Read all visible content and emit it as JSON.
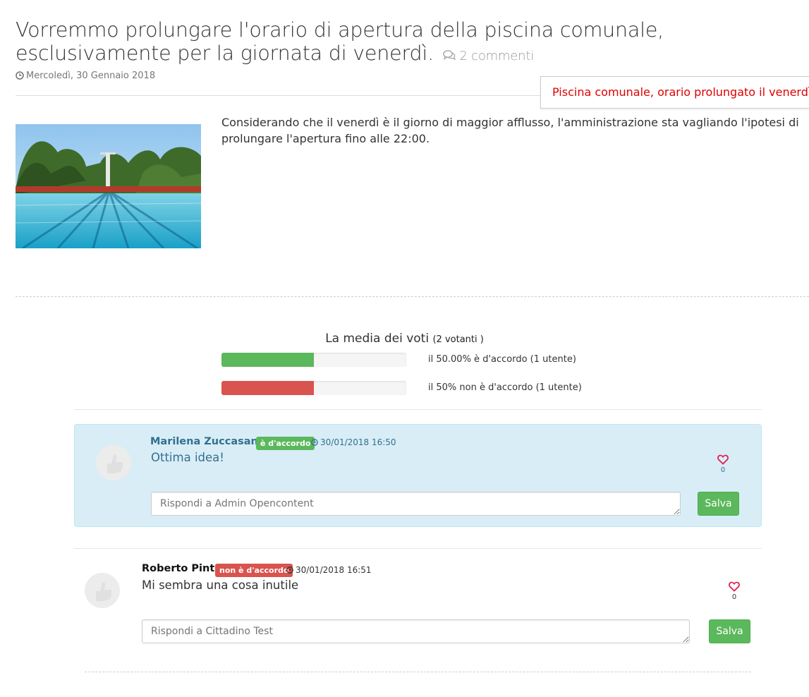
{
  "post": {
    "title": "Vorremmo prolungare l'orario di apertura della piscina comunale, esclusivamente per la giornata di venerdì.",
    "comments_link": "2 commenti",
    "date": "Mercoledì, 30 Gennaio 2018",
    "tag_title": "Piscina comunale, orario prolungato il venerdì",
    "description": "Considerando che il venerdì è il giorno di maggior afflusso, l'amministrazione sta vagliando l'ipotesi di prolungare l'apertura fino alle 22:00."
  },
  "votes": {
    "title": "La media dei voti",
    "voters": "(2 votanti )",
    "agree": {
      "fraction": 0.5,
      "label": "il 50.00% è d'accordo (1 utente)",
      "color": "#5cb85c"
    },
    "disagree": {
      "fraction": 0.5,
      "label": "il 50% non è d'accordo (1 utente)",
      "color": "#d9534f"
    }
  },
  "comments": [
    {
      "author": "Marilena Zuccasana",
      "stance": "è d'accordo",
      "stance_color": "#5cb85c",
      "timestamp": "30/01/2018 16:50",
      "text": "Ottima idea!",
      "likes": "0",
      "reply_placeholder": "Rispondi a Admin Opencontent",
      "save_label": "Salva"
    },
    {
      "author": "Roberto Pinto",
      "stance": "non è d'accordo",
      "stance_color": "#d9534f",
      "timestamp": "30/01/2018 16:51",
      "text": "Mi sembra una cosa inutile",
      "likes": "0",
      "reply_placeholder": "Rispondi a Cittadino Test",
      "save_label": "Salva"
    }
  ],
  "icons": [
    "comments-icon",
    "clock-icon",
    "heart-icon",
    "user-placeholder-icon",
    "pool-photo"
  ]
}
